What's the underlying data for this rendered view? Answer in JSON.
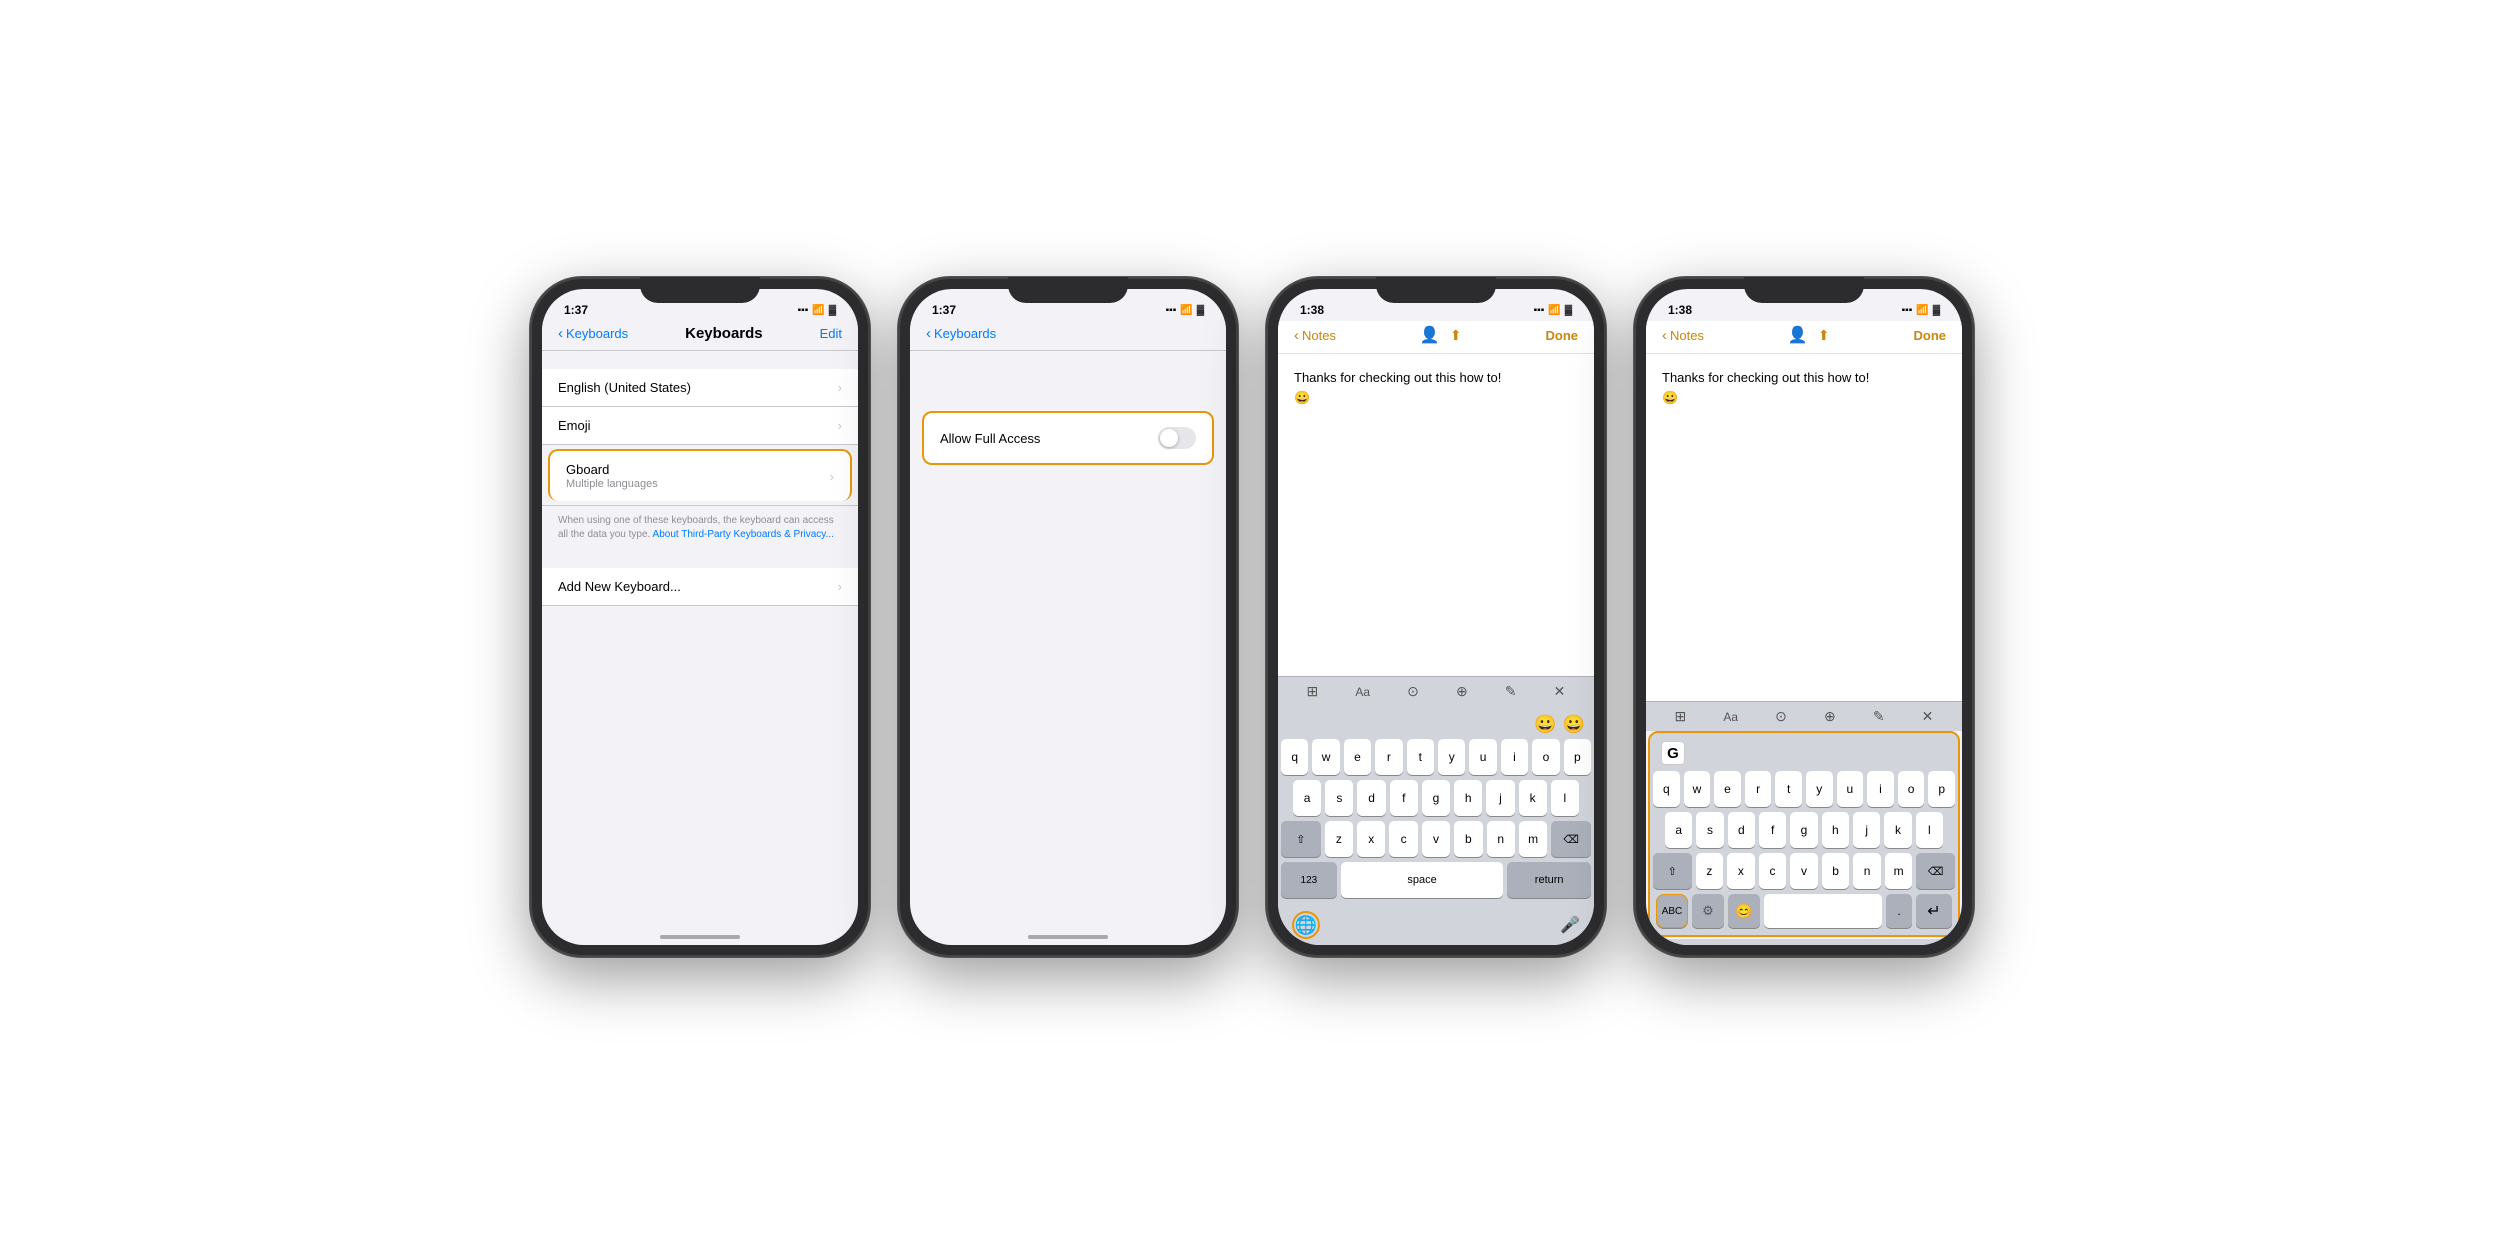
{
  "phones": [
    {
      "id": "phone1",
      "time": "1:37",
      "screen": "keyboards-list",
      "nav": {
        "back_label": "Keyboards",
        "title": "Keyboards",
        "action": "Edit"
      },
      "items": [
        {
          "label": "English (United States)",
          "sub": "",
          "highlighted": false
        },
        {
          "label": "Emoji",
          "sub": "",
          "highlighted": false
        },
        {
          "label": "Gboard",
          "sub": "Multiple languages",
          "highlighted": true
        }
      ],
      "footer": "When using one of these keyboards, the keyboard can access all the data you type.",
      "footer_link": "About Third-Party Keyboards & Privacy...",
      "add_keyboard": "Add New Keyboard..."
    },
    {
      "id": "phone2",
      "time": "1:37",
      "screen": "allow-access",
      "nav": {
        "back_label": "Keyboards",
        "title": "",
        "action": ""
      },
      "allow_full_access": "Allow Full Access"
    },
    {
      "id": "phone3",
      "time": "1:38",
      "screen": "notes-default-keyboard",
      "nav": {
        "back_label": "Notes",
        "title": "",
        "action": "Done"
      },
      "note_text": "Thanks for checking out this how to!\n😀",
      "keyboard_rows": [
        [
          "q",
          "w",
          "e",
          "r",
          "t",
          "y",
          "u",
          "i",
          "o",
          "p"
        ],
        [
          "a",
          "s",
          "d",
          "f",
          "g",
          "h",
          "j",
          "k",
          "l"
        ],
        [
          "z",
          "x",
          "c",
          "v",
          "b",
          "n",
          "m"
        ]
      ],
      "globe_highlighted": true
    },
    {
      "id": "phone4",
      "time": "1:38",
      "screen": "notes-gboard",
      "nav": {
        "back_label": "Notes",
        "title": "",
        "action": "Done"
      },
      "note_text": "Thanks for checking out this how to!\n😀",
      "keyboard_rows": [
        [
          "q",
          "w",
          "e",
          "r",
          "t",
          "y",
          "u",
          "i",
          "o",
          "p"
        ],
        [
          "a",
          "s",
          "d",
          "f",
          "g",
          "h",
          "j",
          "k",
          "l"
        ],
        [
          "z",
          "x",
          "c",
          "v",
          "b",
          "n",
          "m"
        ]
      ],
      "gboard_highlighted": true,
      "abc_label": "ABC"
    }
  ],
  "colors": {
    "orange": "#e8960a",
    "blue": "#007aff",
    "ios_bg": "#f2f2f7",
    "keyboard_bg": "#d1d5db"
  }
}
